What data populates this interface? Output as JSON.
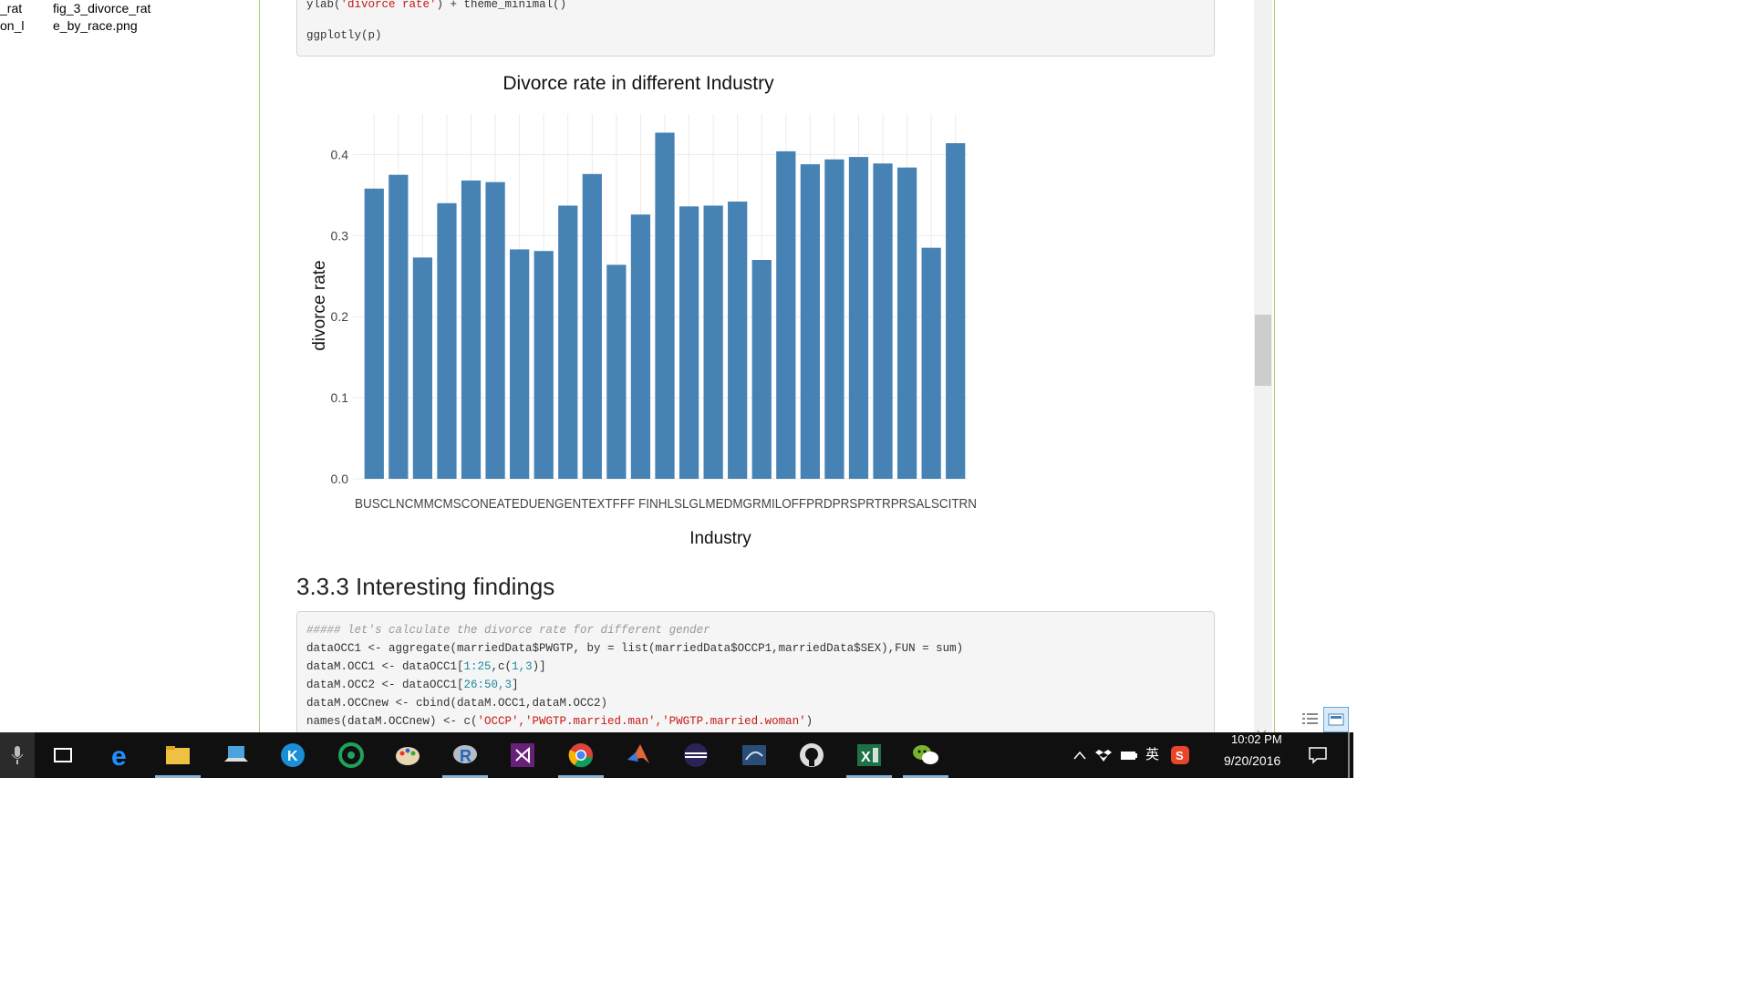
{
  "explorer": {
    "files": [
      {
        "col1": "_rat",
        "col2": "fig_3_divorce_rat"
      },
      {
        "col1": "on_l",
        "col2": "e_by_race.png"
      }
    ]
  },
  "code_block_1": {
    "line1_fn": "ylab(",
    "line1_str": "'divorce rate'",
    "line1_rest": ") + theme_minimal()",
    "line2": "ggplotly(p)"
  },
  "section": {
    "heading": "3.3.3 Interesting findings"
  },
  "code_block_2": {
    "comment": "##### let's calculate the divorce rate for different gender",
    "line2": "dataOCC1 <- aggregate(marriedData$PWGTP, by = list(marriedData$OCCP1,marriedData$SEX),FUN = sum)",
    "line3_a": "dataM.OCC1 <- dataOCC1[",
    "line3_b": "1:25",
    "line3_c": ",c(",
    "line3_d": "1,3",
    "line3_e": ")]",
    "line4_a": "dataM.OCC2 <- dataOCC1[",
    "line4_b": "26:50,3",
    "line4_c": "]",
    "line5": "dataM.OCCnew <- cbind(dataM.OCC1,dataM.OCC2)",
    "line6_a": "names(dataM.OCCnew) <- c(",
    "line6_b": "'OCCP','PWGTP.married.man','PWGTP.married.woman'",
    "line6_c": ")"
  },
  "chart_data": {
    "type": "bar",
    "title": "Divorce rate in different Industry",
    "xlabel": "Industry",
    "ylabel": "divorce rate",
    "ylim": [
      0,
      0.45
    ],
    "yticks": [
      "0.0",
      "0.1",
      "0.2",
      "0.3",
      "0.4"
    ],
    "categories": [
      "BUS",
      "CLN",
      "CMM",
      "CMS",
      "CON",
      "EAT",
      "EDU",
      "ENG",
      "ENT",
      "EXT",
      "FFF",
      "FIN",
      "HLS",
      "LGL",
      "MED",
      "MGR",
      "MIL",
      "OFF",
      "PRD",
      "PRS",
      "PRT",
      "TRP",
      "RSS",
      "ALS",
      "CIT",
      "RN"
    ],
    "values": [
      0.358,
      0.375,
      0.273,
      0.34,
      0.368,
      0.366,
      0.283,
      0.281,
      0.337,
      0.376,
      0.264,
      0.326,
      0.427,
      0.336,
      0.337,
      0.342,
      0.27,
      0.404,
      0.388,
      0.394,
      0.397,
      0.389,
      0.384,
      0.285,
      0.414
    ],
    "bar_color": "#4682b4",
    "grid": true,
    "xtick_text": "BUSCLNCMMCMSCONEATEDUENGENTEXTFFF FINHLSLGLMEDMGRMILOFFPRDPRSPRTRPRSALSCITRN"
  },
  "taskbar": {
    "time": "10:02 PM",
    "date": "9/20/2016",
    "ime_label": "英",
    "icons": [
      "microphone-icon",
      "task-view-icon",
      "edge-icon",
      "file-explorer-icon",
      "laptop-icon",
      "k-app-icon",
      "green-app-icon",
      "paint-icon",
      "r-icon",
      "visual-studio-icon",
      "chrome-icon",
      "matlab-icon",
      "eclipse-icon",
      "sql-icon",
      "github-icon",
      "excel-icon",
      "wechat-icon"
    ]
  },
  "colors": {
    "accent_border": "#a7d07a",
    "taskbar_bg": "#101010"
  }
}
